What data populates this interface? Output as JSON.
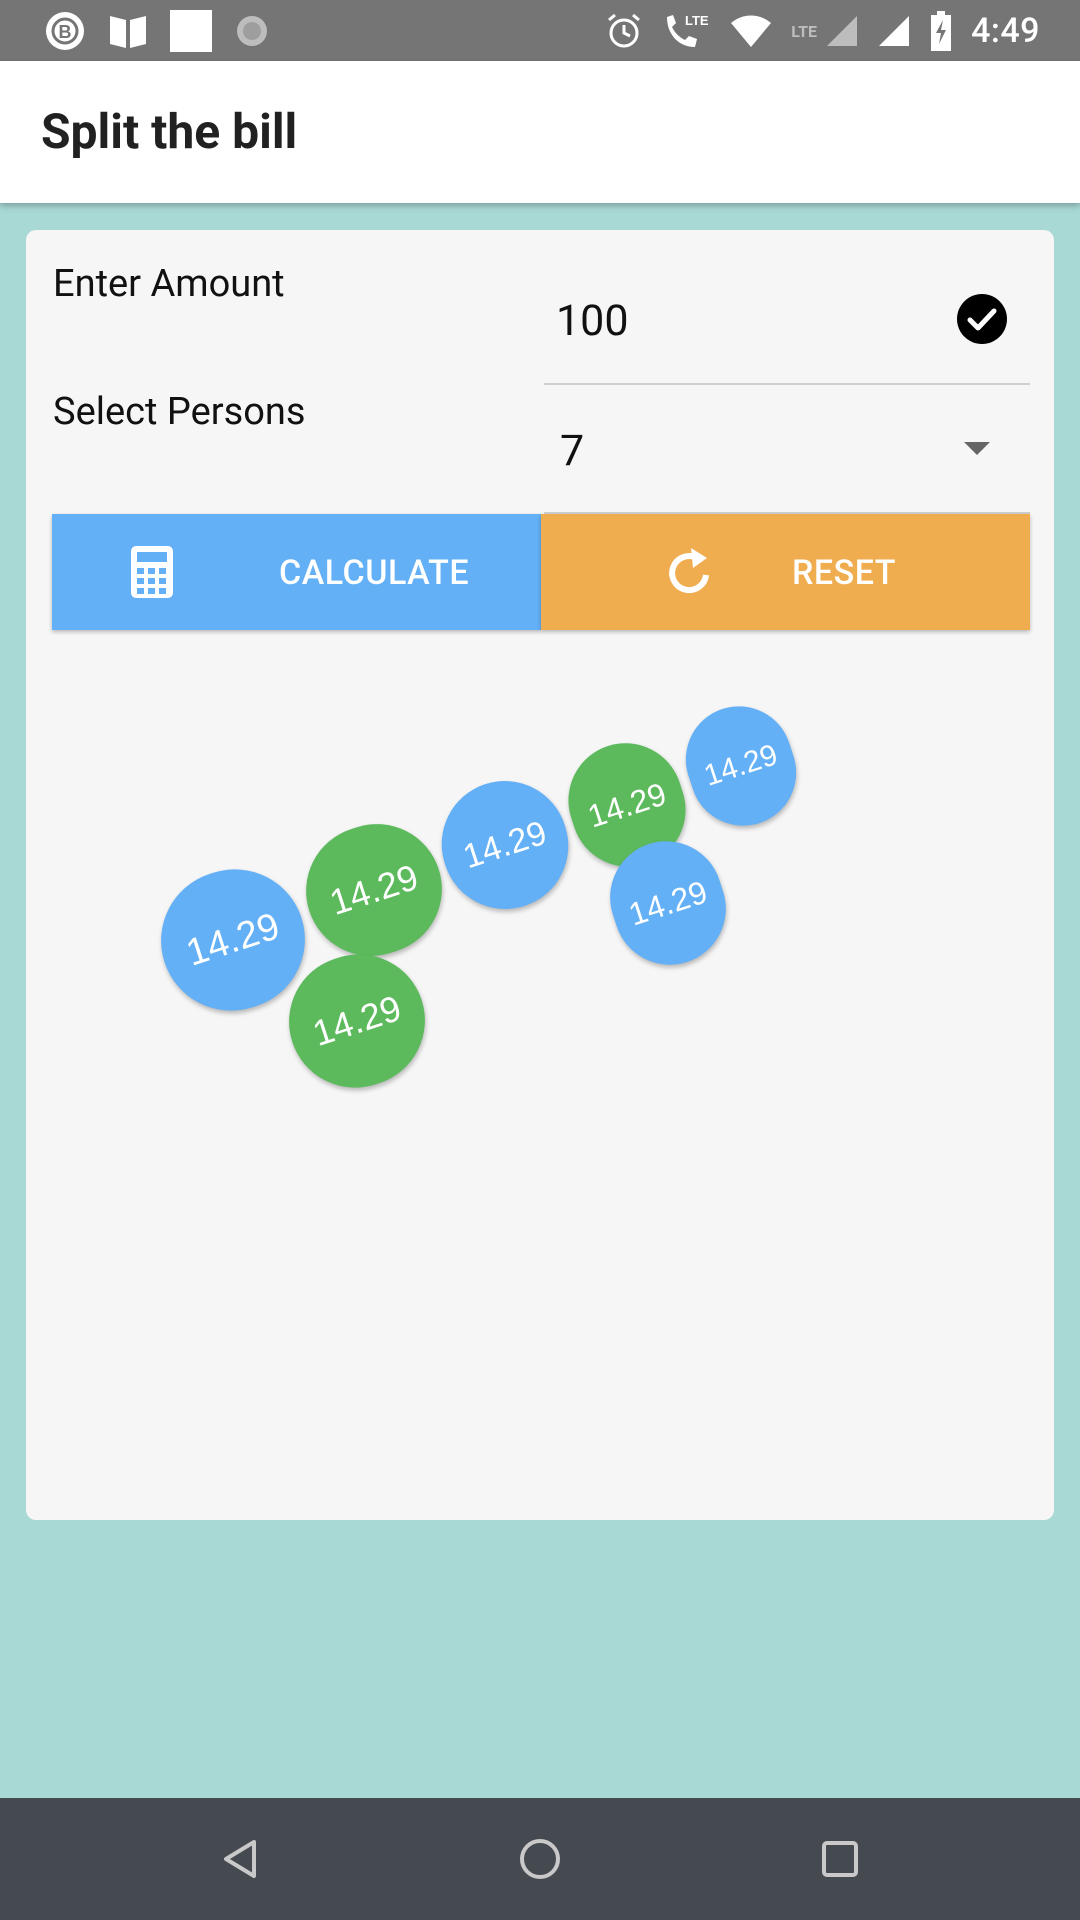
{
  "status_bar": {
    "time": "4:49",
    "network_label": "LTE",
    "left_icons": [
      "b-logo-icon",
      "book-icon",
      "square-icon",
      "spinner-icon"
    ],
    "right_icons": [
      "alarm-icon",
      "volte-call-icon",
      "wifi-icon",
      "signal-icon",
      "signal-icon",
      "battery-charging-icon"
    ]
  },
  "app_bar": {
    "title": "Split the bill"
  },
  "form": {
    "amount_label": "Enter Amount",
    "amount_value": "100",
    "persons_label": "Select Persons",
    "persons_value": "7"
  },
  "buttons": {
    "calculate": "CALCULATE",
    "reset": "RESET"
  },
  "results": {
    "share_values": [
      "14.29",
      "14.29",
      "14.29",
      "14.29",
      "14.29",
      "14.29",
      "14.29"
    ],
    "colors": [
      "blue",
      "green",
      "green",
      "blue",
      "green",
      "blue",
      "blue"
    ]
  },
  "theme": {
    "background": "#a9d9d5",
    "card": "#f6f6f6",
    "calculate_color": "#64b0f6",
    "reset_color": "#f0ad50",
    "green": "#5cba5c"
  },
  "navigation": [
    "back-icon",
    "home-icon",
    "recents-icon"
  ]
}
